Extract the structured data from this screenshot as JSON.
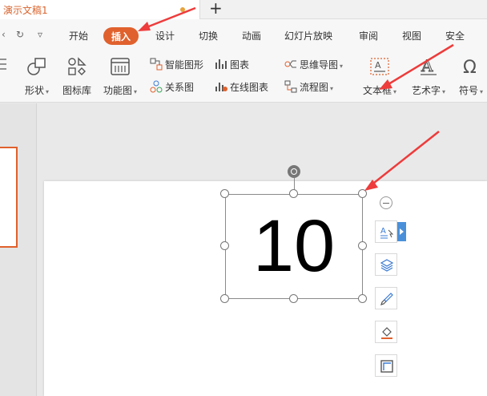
{
  "title_bar": {
    "document_tab": "演示文稿1",
    "new_tab_label": "+"
  },
  "menu": {
    "items": [
      "开始",
      "插入",
      "设计",
      "切换",
      "动画",
      "幻灯片放映",
      "审阅",
      "视图",
      "安全"
    ],
    "active": "插入"
  },
  "ribbon": {
    "shape": "形状",
    "icon_library": "图标库",
    "function_chart": "功能图",
    "smart_graphic": "智能图形",
    "chart": "图表",
    "relation_chart": "关系图",
    "online_chart": "在线图表",
    "mind_map": "思维导图",
    "flowchart": "流程图",
    "text_box": "文本框",
    "art_text": "艺术字",
    "symbol": "符号",
    "caret": "▾"
  },
  "slide": {
    "text_box_content": "10"
  },
  "colors": {
    "accent": "#e0612d",
    "annotation_arrow": "#ee3b3b",
    "side_expander": "#4a90d9"
  }
}
